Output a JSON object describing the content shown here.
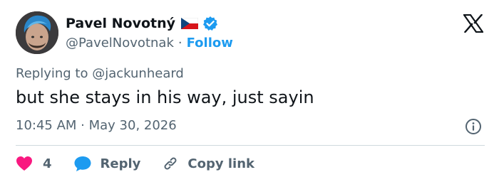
{
  "author": {
    "name": "Pavel Novotný",
    "handle": "@PavelNovotnak",
    "separator": "·",
    "follow_label": "Follow",
    "flag_icon": "czech-flag-icon",
    "verified_icon": "verified-badge-icon",
    "verified_color": "#1d9bf0"
  },
  "tweet": {
    "reply_prefix": "Replying to",
    "reply_to": "@jackunheard",
    "text": "but she stays in his way, just sayin",
    "timestamp": "10:45 AM · May 30, 2026"
  },
  "actions": {
    "like_count": "4",
    "like_color": "#f91880",
    "reply_label": "Reply",
    "reply_color": "#1d9bf0",
    "copy_label": "Copy link"
  },
  "colors": {
    "text_primary": "#0f1419",
    "text_secondary": "#536471",
    "accent": "#1d9bf0",
    "divider": "#cfd9de"
  }
}
